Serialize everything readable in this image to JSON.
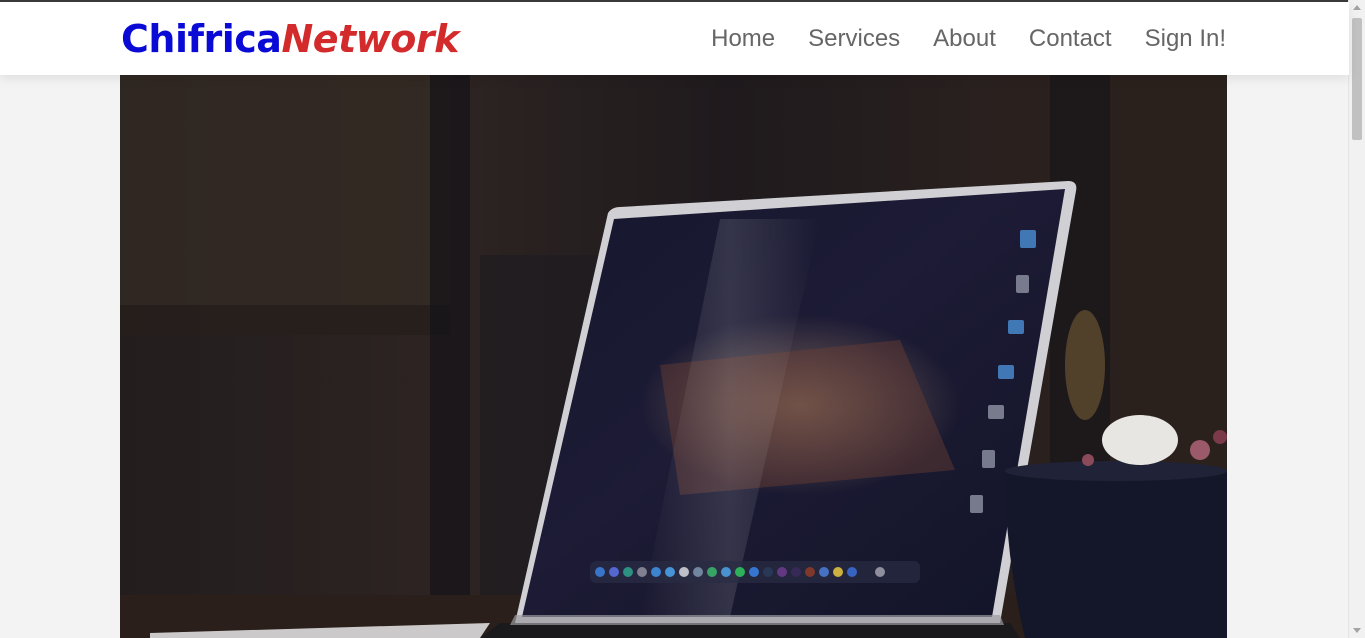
{
  "brand": {
    "part1": "Chifrica",
    "part2": "Network"
  },
  "nav": {
    "items": [
      {
        "label": "Home"
      },
      {
        "label": "Services"
      },
      {
        "label": "About"
      },
      {
        "label": "Contact"
      },
      {
        "label": "Sign In!"
      }
    ]
  },
  "hero": {
    "icon": "laptop-photo"
  },
  "colors": {
    "brand_blue": "#0a0ad6",
    "brand_red": "#d32b2b",
    "nav_text": "#666666"
  }
}
